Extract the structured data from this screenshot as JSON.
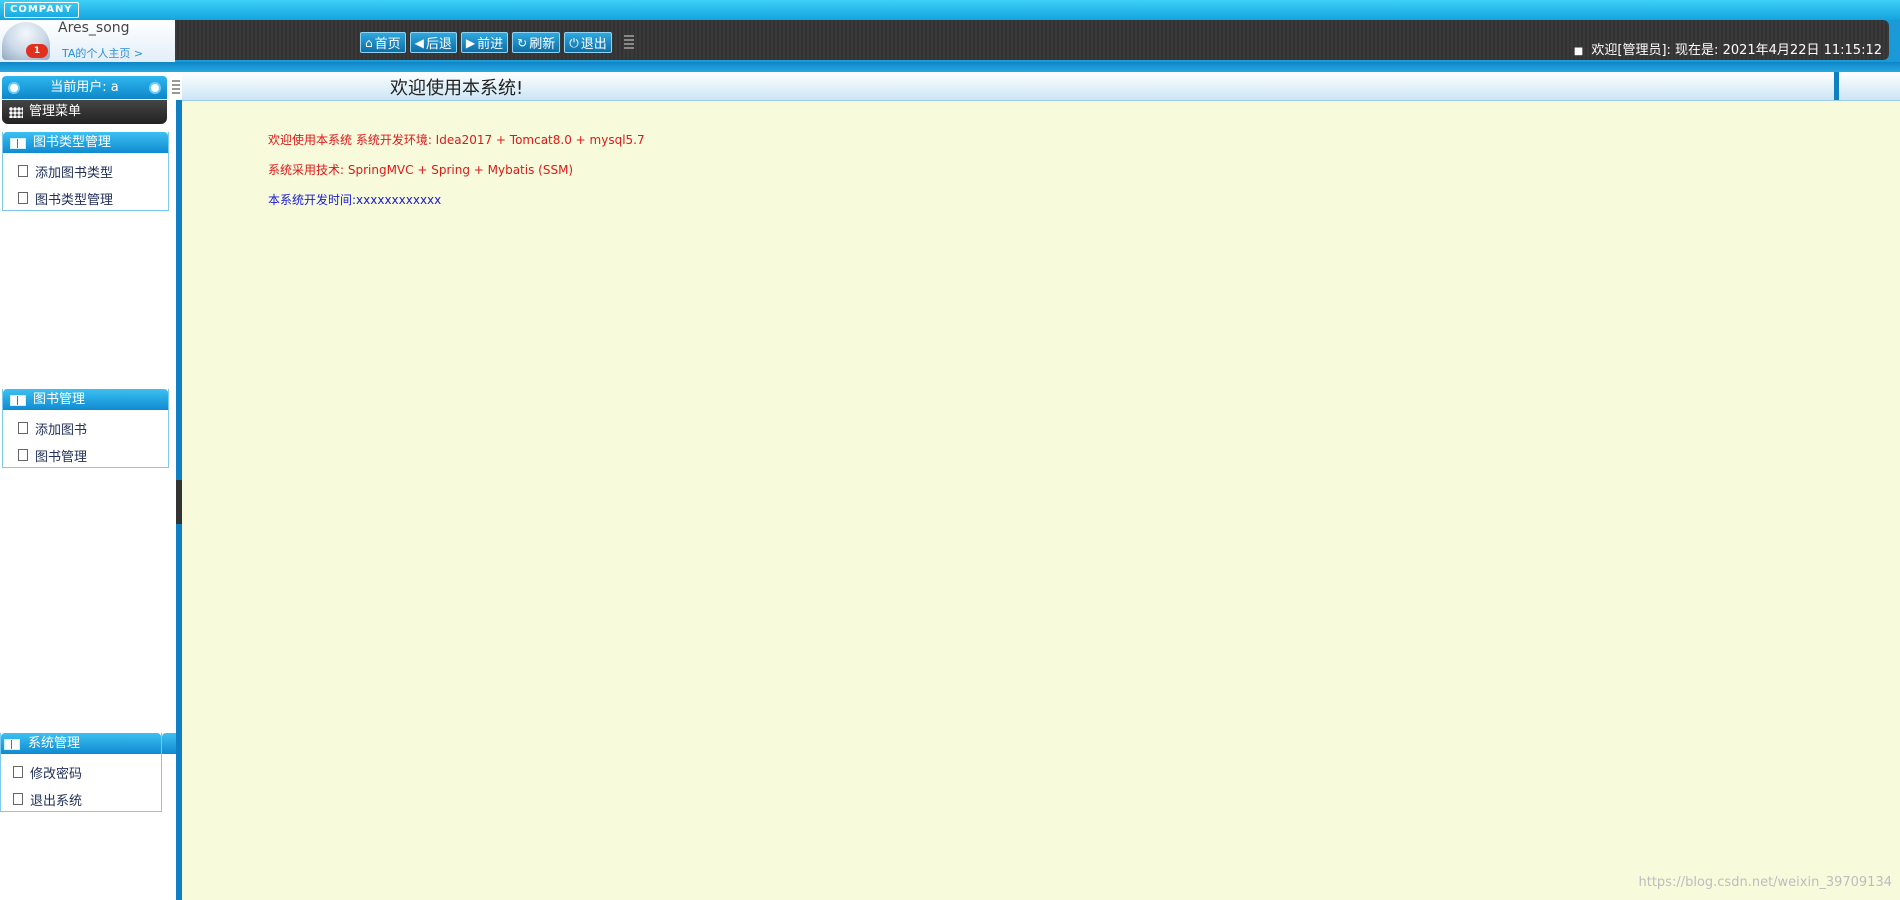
{
  "header": {
    "logo_text": "COMPANY",
    "user": {
      "name": "Ares_song",
      "homepage_link": "TA的个人主页 >",
      "badge_count": "1"
    },
    "toolbar": {
      "buttons": [
        {
          "label": "首页",
          "icon": "home-icon",
          "glyph": "⌂"
        },
        {
          "label": "后退",
          "icon": "back-arrow-icon",
          "glyph": "◀"
        },
        {
          "label": "前进",
          "icon": "forward-arrow-icon",
          "glyph": "▶"
        },
        {
          "label": "刷新",
          "icon": "refresh-icon",
          "glyph": "↻"
        },
        {
          "label": "退出",
          "icon": "power-icon",
          "glyph": "⏻"
        }
      ]
    },
    "welcome_text": "欢迎[管理员]:",
    "time_label": "现在是:",
    "datetime": "2021年4月22日 11:15:12"
  },
  "sidebar": {
    "current_user_label": "当前用户: a",
    "menu_title": "管理菜单",
    "groups": [
      {
        "title": "图书类型管理",
        "items": [
          "添加图书类型",
          "图书类型管理"
        ]
      },
      {
        "title": "图书管理",
        "items": [
          "添加图书",
          "图书管理"
        ]
      },
      {
        "title": "系统管理",
        "items": [
          "修改密码",
          "退出系统"
        ]
      }
    ]
  },
  "main": {
    "title": "欢迎使用本系统!",
    "lines": {
      "env": "欢迎使用本系统 系统开发环境: Idea2017 + Tomcat8.0 + mysql5.7",
      "tech": "系统采用技术: SpringMVC + Spring + Mybatis (SSM)",
      "time": "本系统开发时间:xxxxxxxxxxxx"
    }
  },
  "watermark": "https://blog.csdn.net/weixin_39709134",
  "colors": {
    "accent": "#1a9bd8",
    "content_bg": "#f7fbdc",
    "text_red": "#e01818",
    "text_blue": "#1a1ad8"
  }
}
